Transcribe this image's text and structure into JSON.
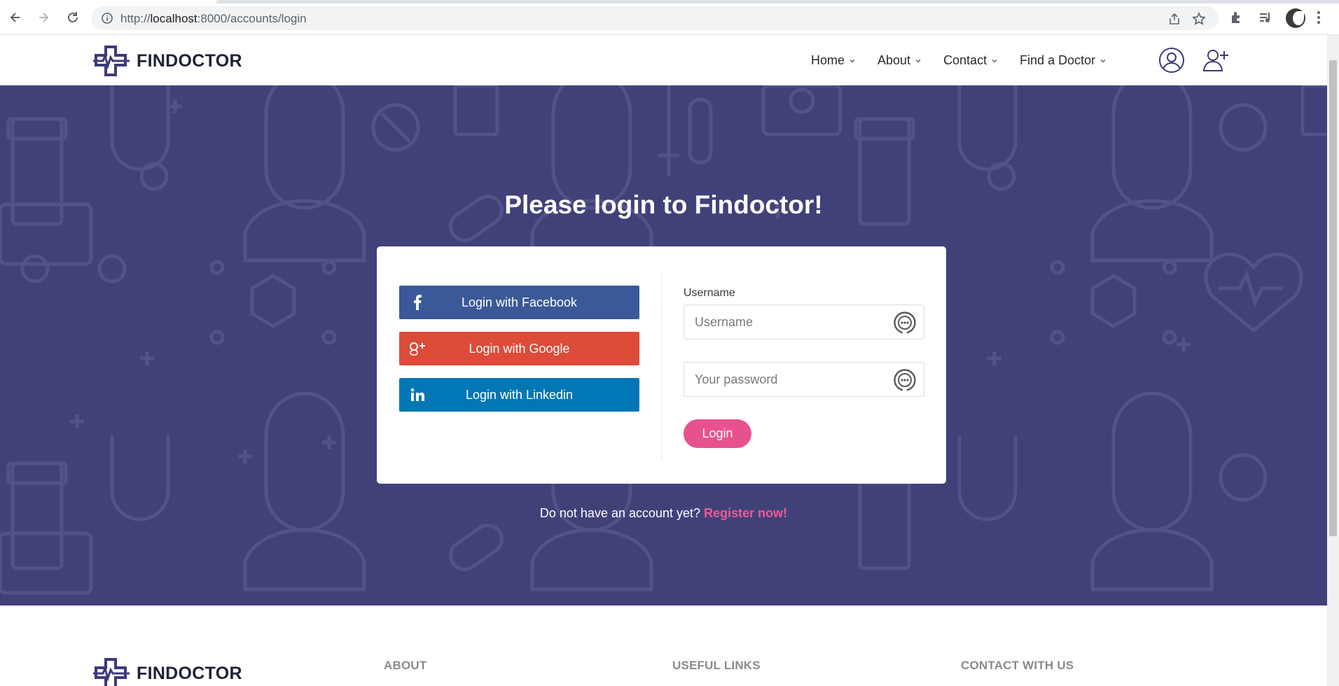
{
  "browser": {
    "url_prefix": "http://",
    "url_host": "localhost",
    "url_rest": ":8000/accounts/login"
  },
  "site": {
    "brand": "FINDOCTOR",
    "nav": [
      {
        "label": "Home"
      },
      {
        "label": "About"
      },
      {
        "label": "Contact"
      },
      {
        "label": "Find a Doctor"
      }
    ]
  },
  "login": {
    "title": "Please login to Findoctor!",
    "facebook_label": "Login with Facebook",
    "google_label": "Login with Google",
    "linkedin_label": "Login with Linkedin",
    "username_label": "Username",
    "username_placeholder": "Username",
    "password_placeholder": "Your password",
    "submit_label": "Login",
    "no_account_text": "Do not have an account yet?",
    "register_link": "Register now!"
  },
  "footer": {
    "brand": "FINDOCTOR",
    "col_about": "ABOUT",
    "col_links": "USEFUL LINKS",
    "col_contact": "CONTACT WITH US"
  },
  "colors": {
    "hero_bg": "#414179",
    "facebook": "#3b5898",
    "google": "#dd4b39",
    "linkedin": "#0177b5",
    "accent_pink": "#e8528c"
  },
  "icons": {
    "header_user": "user-icon",
    "header_add_user": "add-user-icon",
    "field_key": "password-manager-icon"
  }
}
